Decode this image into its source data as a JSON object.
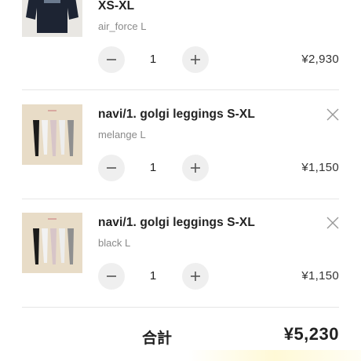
{
  "items": [
    {
      "title": "XS-XL",
      "variant": "air_force L",
      "quantity": "1",
      "price": "¥2,930",
      "image": "sweatshirt-thumbnail",
      "removable": false
    },
    {
      "title": "navi/1. golgi leggings S-XL",
      "variant": "melange L",
      "quantity": "1",
      "price": "¥1,150",
      "image": "leggings-thumbnail",
      "removable": true
    },
    {
      "title": "navi/1. golgi leggings S-XL",
      "variant": "black L",
      "quantity": "1",
      "price": "¥1,150",
      "image": "leggings-thumbnail",
      "removable": true
    }
  ],
  "summary": {
    "total_label": "合計",
    "total_value": "¥5,230"
  },
  "icons": {
    "decrement": "minus-icon",
    "increment": "plus-icon",
    "remove": "close-icon"
  },
  "colors": {
    "stepper_bg": "#efefef",
    "divider": "#e6e6e6",
    "text": "#222222",
    "muted": "#8a8a8a"
  }
}
